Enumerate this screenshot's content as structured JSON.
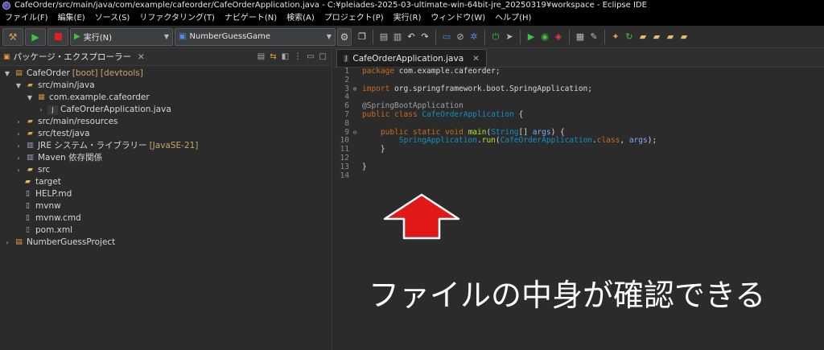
{
  "window": {
    "title": "CafeOrder/src/main/java/com/example/cafeorder/CafeOrderApplication.java - C:¥pleiades-2025-03-ultimate-win-64bit-jre_20250319¥workspace - Eclipse IDE"
  },
  "menu": [
    "ファイル(F)",
    "編集(E)",
    "ソース(S)",
    "リファクタリング(T)",
    "ナビゲート(N)",
    "検索(A)",
    "プロジェクト(P)",
    "実行(R)",
    "ウィンドウ(W)",
    "ヘルプ(H)"
  ],
  "toolbar": {
    "run_mode_label": "実行(N)",
    "launch_config": "NumberGuessGame"
  },
  "explorer": {
    "title": "パッケージ・エクスプローラー",
    "tree": [
      {
        "label": "CafeOrder",
        "decor": "[boot] [devtools]",
        "icon": "project-icon"
      },
      {
        "label": "src/main/java",
        "decor": "",
        "icon": "source-folder-icon"
      },
      {
        "label": "com.example.cafeorder",
        "decor": "",
        "icon": "package-icon"
      },
      {
        "label": "CafeOrderApplication.java",
        "decor": "",
        "icon": "java-file-icon"
      },
      {
        "label": "src/main/resources",
        "decor": "",
        "icon": "source-folder-icon"
      },
      {
        "label": "src/test/java",
        "decor": "",
        "icon": "source-folder-icon"
      },
      {
        "label": "JRE システム・ライブラリー",
        "decor": "[JavaSE-21]",
        "icon": "library-icon"
      },
      {
        "label": "Maven 依存関係",
        "decor": "",
        "icon": "library-icon"
      },
      {
        "label": "src",
        "decor": "",
        "icon": "folder-icon"
      },
      {
        "label": "target",
        "decor": "",
        "icon": "folder-icon"
      },
      {
        "label": "HELP.md",
        "decor": "",
        "icon": "file-icon"
      },
      {
        "label": "mvnw",
        "decor": "",
        "icon": "file-icon"
      },
      {
        "label": "mvnw.cmd",
        "decor": "",
        "icon": "file-icon"
      },
      {
        "label": "pom.xml",
        "decor": "",
        "icon": "xml-file-icon"
      },
      {
        "label": "NumberGuessProject",
        "decor": "",
        "icon": "project-icon"
      }
    ]
  },
  "editor": {
    "tab_label": "CafeOrderApplication.java",
    "lines": [
      {
        "n": "1",
        "text": "package com.example.cafeorder;"
      },
      {
        "n": "2",
        "text": ""
      },
      {
        "n": "3",
        "text": "import org.springframework.boot.SpringApplication;"
      },
      {
        "n": "4",
        "text": ""
      },
      {
        "n": "6",
        "text": "@SpringBootApplication"
      },
      {
        "n": "7",
        "text": "public class CafeOrderApplication {"
      },
      {
        "n": "8",
        "text": ""
      },
      {
        "n": "9",
        "text": "    public static void main(String[] args) {"
      },
      {
        "n": "10",
        "text": "        SpringApplication.run(CafeOrderApplication.class, args);"
      },
      {
        "n": "11",
        "text": "    }"
      },
      {
        "n": "12",
        "text": ""
      },
      {
        "n": "13",
        "text": "}"
      },
      {
        "n": "14",
        "text": ""
      }
    ]
  },
  "annotation": {
    "caption": "ファイルの中身が確認できる",
    "arrow_color": "#e01818"
  }
}
